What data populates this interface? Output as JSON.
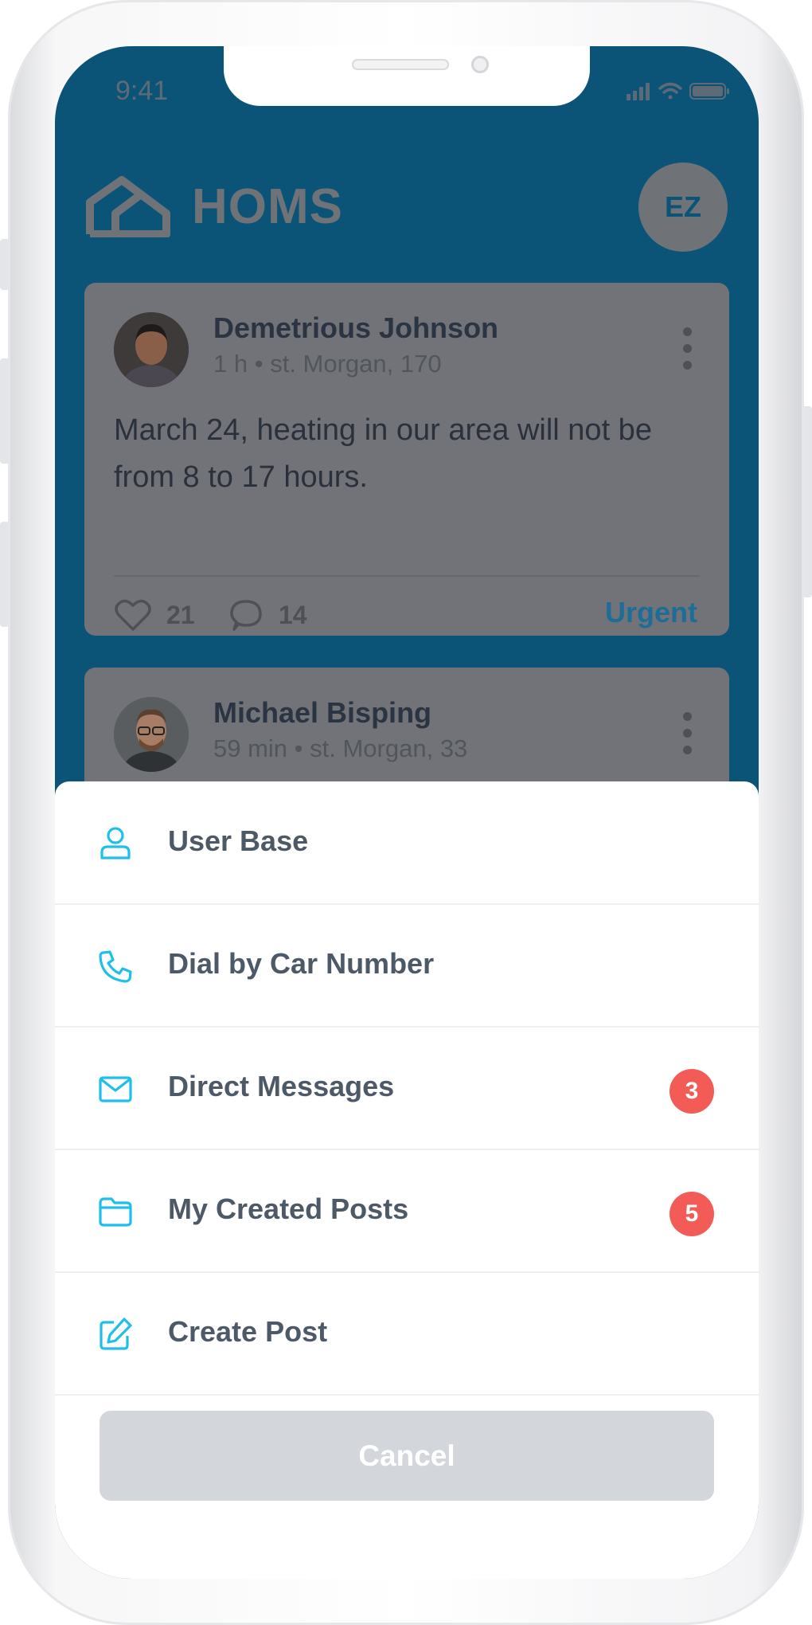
{
  "status_bar": {
    "time": "9:41"
  },
  "header": {
    "brand": "HOMS",
    "user_initials": "EZ"
  },
  "posts": [
    {
      "author": "Demetrious Johnson",
      "time": "1 h",
      "location": "st. Morgan, 170",
      "text": "March 24, heating in our area will not be from 8 to 17 hours.",
      "likes": "21",
      "comments": "14",
      "tag": "Urgent"
    },
    {
      "author": "Michael Bisping",
      "time": "59 min",
      "location": "st. Morgan, 33"
    }
  ],
  "menu": {
    "items": [
      {
        "label": "User Base",
        "icon": "user-icon"
      },
      {
        "label": "Dial by Car Number",
        "icon": "phone-icon"
      },
      {
        "label": "Direct Messages",
        "icon": "mail-icon",
        "badge": "3"
      },
      {
        "label": "My Created Posts",
        "icon": "folder-icon",
        "badge": "5"
      },
      {
        "label": "Create Post",
        "icon": "edit-icon"
      }
    ],
    "cancel_label": "Cancel"
  },
  "colors": {
    "accent": "#1ec0ea",
    "badge": "#f25b56",
    "header_bg": "#0b5477",
    "urgent": "#1d6d96"
  }
}
